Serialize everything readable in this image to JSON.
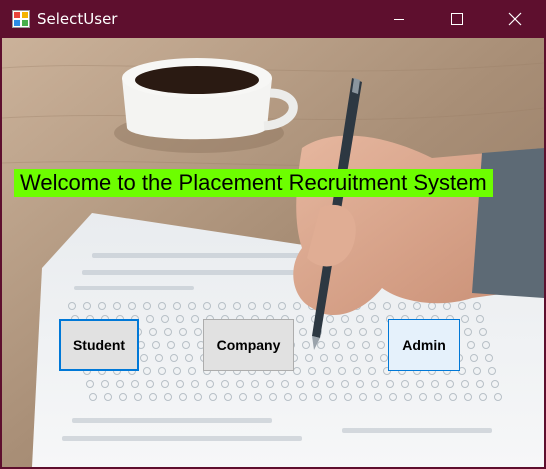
{
  "window": {
    "title": "SelectUser",
    "controls": {
      "minimize_icon": "minimize-icon",
      "maximize_icon": "maximize-icon",
      "close_icon": "close-icon"
    },
    "title_bar_color": "#5e0f2e"
  },
  "content": {
    "welcome_text": "Welcome to the Placement Recruitment System",
    "welcome_bg": "#6dfe00",
    "buttons": {
      "student": "Student",
      "company": "Company",
      "admin": "Admin"
    }
  }
}
